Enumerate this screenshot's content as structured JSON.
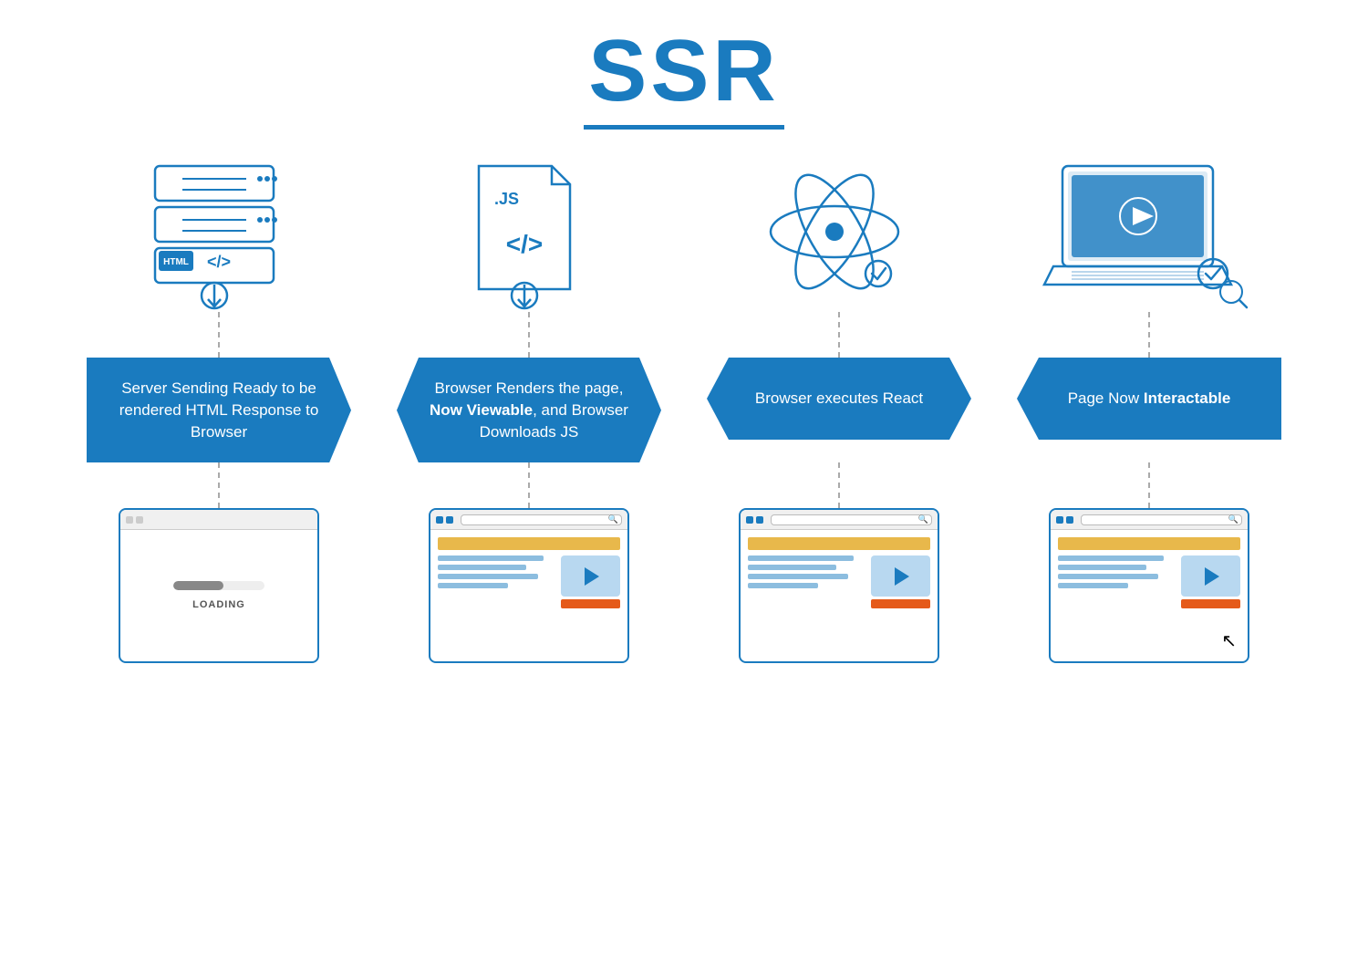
{
  "title": {
    "main": "SSR",
    "underline": true
  },
  "columns": [
    {
      "id": "col1",
      "icon_type": "html_stack",
      "box_text": "Server Sending Ready to be rendered HTML Response to Browser",
      "box_bold": "",
      "box_class": "col1",
      "bottom_state": "loading"
    },
    {
      "id": "col2",
      "icon_type": "js_file",
      "box_text_pre": "Browser Renders the page, ",
      "box_text_bold": "Now Viewable",
      "box_text_post": ", and Browser Downloads JS",
      "box_class": "col2",
      "bottom_state": "content"
    },
    {
      "id": "col3",
      "icon_type": "react_atom",
      "box_text": "Browser executes React",
      "box_bold": "",
      "box_class": "col3",
      "bottom_state": "content"
    },
    {
      "id": "col4",
      "icon_type": "laptop",
      "box_text_pre": "Page Now ",
      "box_text_bold": "Interactable",
      "box_text_post": "",
      "box_class": "col4",
      "bottom_state": "content_cursor"
    }
  ],
  "loading_text": "LOADING"
}
